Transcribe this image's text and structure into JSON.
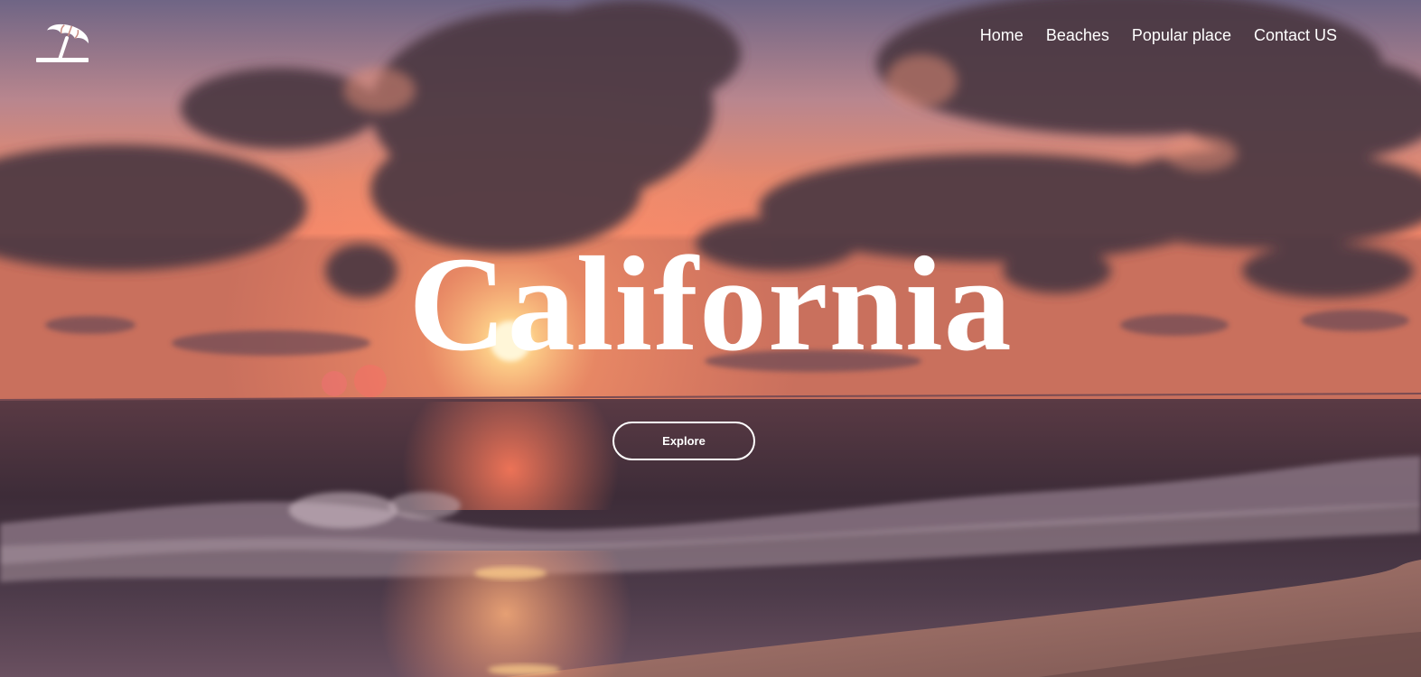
{
  "logo": {
    "icon": "beach-umbrella-icon"
  },
  "nav": {
    "items": [
      {
        "label": "Home"
      },
      {
        "label": "Beaches"
      },
      {
        "label": "Popular place"
      },
      {
        "label": "Contact US"
      }
    ]
  },
  "hero": {
    "title": "California",
    "button_label": "Explore",
    "background": "sunset-over-ocean-beach"
  },
  "colors": {
    "text": "#ffffff",
    "sky_top": "#7a6e86",
    "sky_glow": "#f08a6c",
    "sun": "#ffe6a8",
    "sea": "#3e2c38",
    "sand": "#9e6f68",
    "clouds": "#4a3540"
  }
}
